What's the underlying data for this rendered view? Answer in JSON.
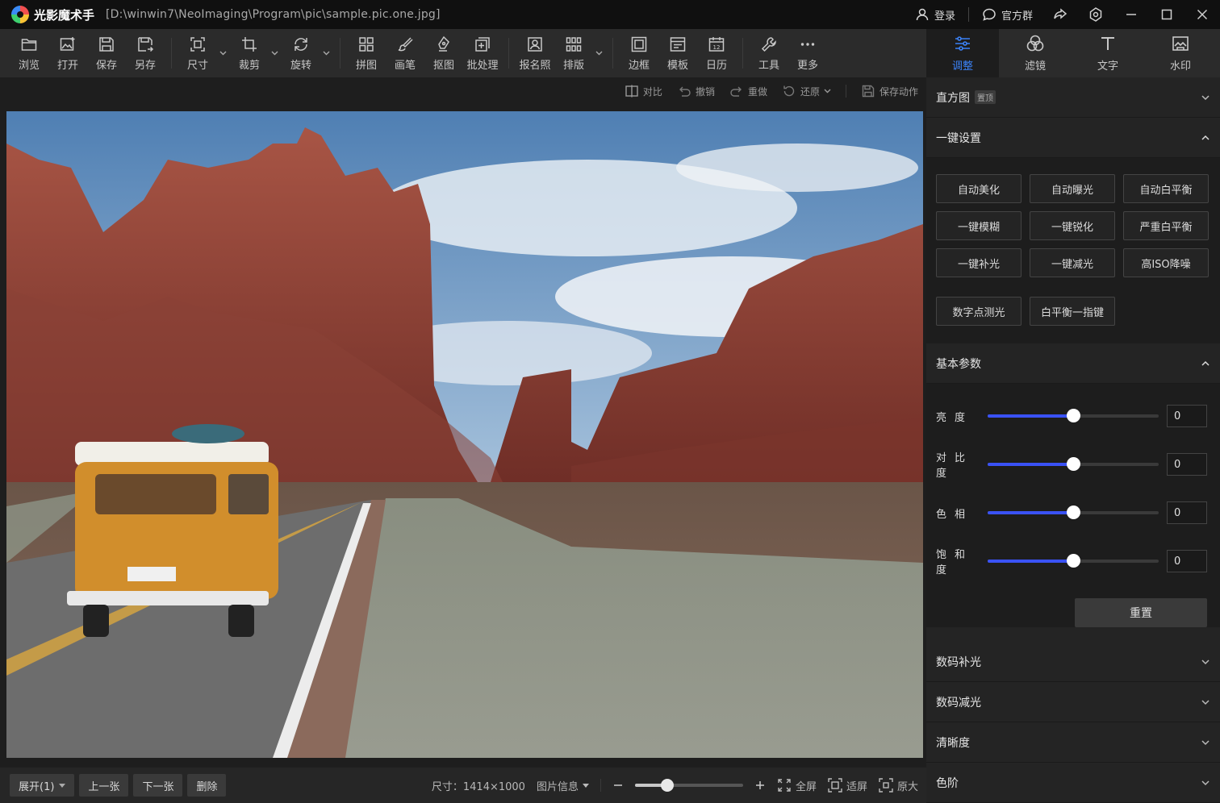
{
  "app": {
    "name": "光影魔术手",
    "file_path": "[D:\\winwin7\\NeoImaging\\Program\\pic\\sample.pic.one.jpg]",
    "login_label": "登录",
    "group_label": "官方群"
  },
  "toolbar": {
    "browse": "浏览",
    "open": "打开",
    "save": "保存",
    "save_as": "另存",
    "size": "尺寸",
    "crop": "裁剪",
    "rotate": "旋转",
    "collage": "拼图",
    "brush": "画笔",
    "cutout": "抠图",
    "batch": "批处理",
    "id_photo": "报名照",
    "layout": "排版",
    "border": "边框",
    "template": "模板",
    "calendar": "日历",
    "tools": "工具",
    "more": "更多"
  },
  "subbar": {
    "compare": "对比",
    "undo": "撤销",
    "redo": "重做",
    "restore": "还原",
    "save_action": "保存动作"
  },
  "bottombar": {
    "expand": "展开(1)",
    "prev": "上一张",
    "next": "下一张",
    "delete": "删除",
    "size_info": "尺寸：1414×1000",
    "image_info": "图片信息",
    "zoom_level": 0.3,
    "fullscreen": "全屏",
    "fit": "适屏",
    "original": "原大"
  },
  "right_panel": {
    "tabs": [
      "调整",
      "滤镜",
      "文字",
      "水印"
    ],
    "active_tab": "调整",
    "histogram": {
      "label": "直方图",
      "badge": "置顶"
    },
    "quick": {
      "label": "一键设置",
      "buttons": [
        "自动美化",
        "自动曝光",
        "自动白平衡",
        "一键模糊",
        "一键锐化",
        "严重白平衡",
        "一键补光",
        "一键减光",
        "高ISO降噪",
        "数字点测光",
        "白平衡一指键"
      ]
    },
    "basic": {
      "label": "基本参数",
      "params": [
        {
          "label": "亮度",
          "value": "0",
          "level": 0.5
        },
        {
          "label": "对比度",
          "value": "0",
          "level": 0.5
        },
        {
          "label": "色相",
          "value": "0",
          "level": 0.5
        },
        {
          "label": "饱和度",
          "value": "0",
          "level": 0.5
        }
      ],
      "reset_label": "重置"
    },
    "sections": [
      "数码补光",
      "数码减光",
      "清晰度",
      "色阶"
    ]
  },
  "colors": {
    "accent": "#3b82f6",
    "slider_fill": "#3a52f5"
  }
}
